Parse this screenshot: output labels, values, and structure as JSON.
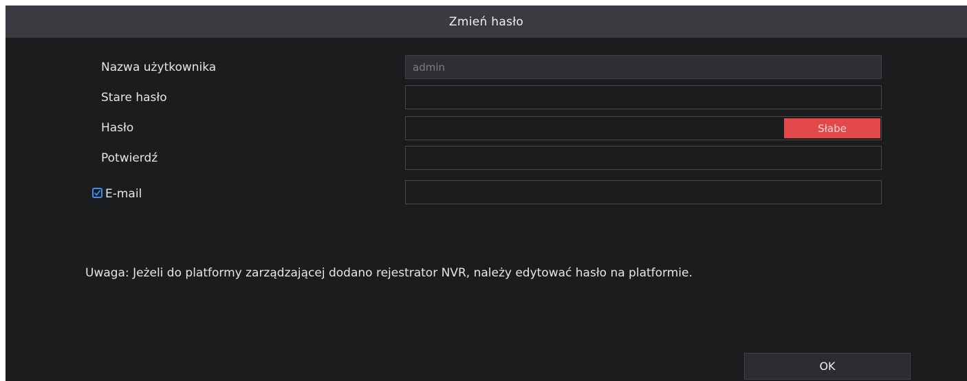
{
  "dialog": {
    "title": "Zmień hasło"
  },
  "form": {
    "username_label": "Nazwa użytkownika",
    "username_value": "admin",
    "old_password_label": "Stare hasło",
    "password_label": "Hasło",
    "password_strength": "Słabe",
    "confirm_label": "Potwierdź",
    "email_label": "E-mail",
    "email_checked": true
  },
  "note": "Uwaga: Jeżeli do platformy zarządzającej dodano rejestrator NVR, należy edytować hasło na platformie.",
  "buttons": {
    "ok_label": "OK"
  },
  "colors": {
    "background": "#1b1c1e",
    "titlebar": "#3a3b40",
    "strength_weak": "#e2474a",
    "checkbox_accent": "#3d8ef0"
  }
}
